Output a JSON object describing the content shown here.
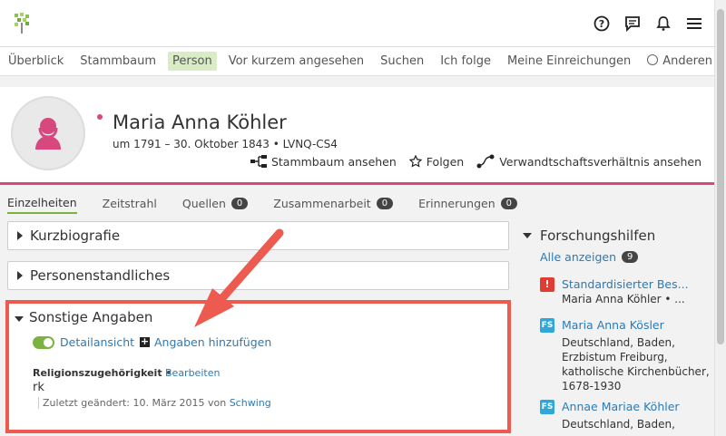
{
  "nav": {
    "items": [
      "Überblick",
      "Stammbaum",
      "Person",
      "Vor kurzem angesehen",
      "Suchen",
      "Ich folge",
      "Meine Einreichungen"
    ],
    "active_index": 2,
    "help_others": "Anderen helfen"
  },
  "top_icons": [
    "help-icon",
    "chat-icon",
    "bell-icon",
    "menu-icon"
  ],
  "person": {
    "name": "Maria Anna Köhler",
    "lifespan": "um 1791 – 30. Oktober 1843 • LVNQ-CS4",
    "gender_color": "#d6487e",
    "actions": {
      "tree": "Stammbaum ansehen",
      "follow": "Folgen",
      "relationship": "Verwandtschaftsverhältnis ansehen"
    }
  },
  "tabs": [
    {
      "label": "Einzelheiten",
      "count": null
    },
    {
      "label": "Zeitstrahl",
      "count": null
    },
    {
      "label": "Quellen",
      "count": "0"
    },
    {
      "label": "Zusammenarbeit",
      "count": "0"
    },
    {
      "label": "Erinnerungen",
      "count": "0"
    }
  ],
  "sections": {
    "kurzbiografie": "Kurzbiografie",
    "personenstand": "Personenstandliches",
    "sonstige": {
      "title": "Sonstige Angaben",
      "detail_toggle": "Detailansicht",
      "add": "Angaben hinzufügen",
      "field_label": "Religionszugehörigkeit",
      "edit": "Bearbeiten",
      "value": "rk",
      "changed_prefix": "Zuletzt geändert: 10. März 2015 von",
      "changed_by": "Schwing"
    }
  },
  "research": {
    "title": "Forschungshilfen",
    "show_all": "Alle anzeigen",
    "count": "9",
    "hints": [
      {
        "icon": "!",
        "color": "#e03c31",
        "title": "Standardisierter Bes...",
        "lines": [
          "Maria Anna Köhler  •  ..."
        ]
      },
      {
        "icon": "FS",
        "color": "#2fa7d8",
        "title": "Maria Anna Kösler",
        "lines": [
          "Deutschland, Baden,",
          "Erzbistum Freiburg,",
          "katholische Kirchenbücher,",
          "1678-1930"
        ]
      },
      {
        "icon": "FS",
        "color": "#2fa7d8",
        "title": "Annae Mariae Köhler",
        "lines": [
          "Deutschland, Baden,"
        ]
      }
    ]
  },
  "colors": {
    "accent_green": "#7bb241",
    "link": "#2a7ab8",
    "highlight_red": "#ed5a50"
  }
}
